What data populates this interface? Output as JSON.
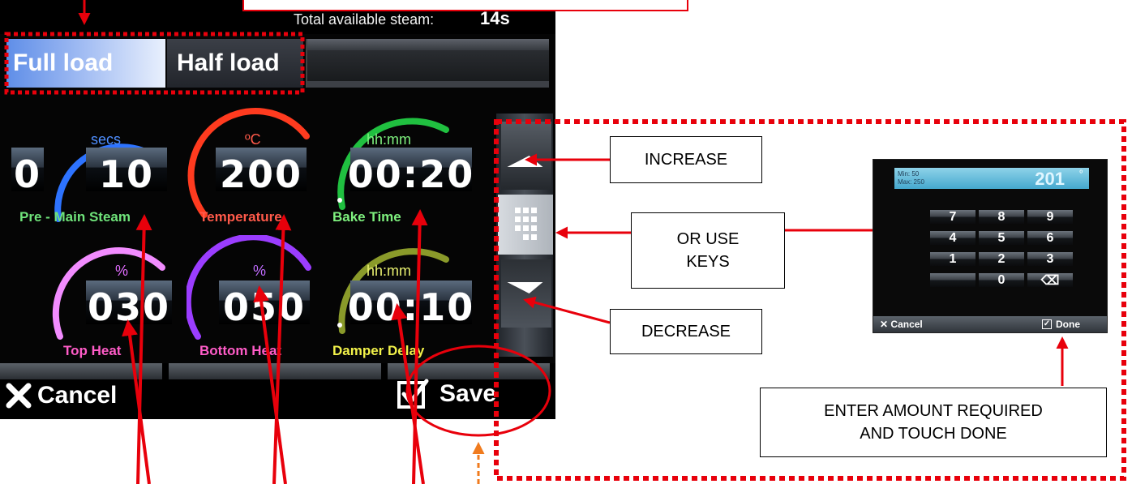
{
  "screen": {
    "steam_label": "Total available steam:",
    "steam_value": "14s",
    "tabs": [
      {
        "label": "Full load",
        "active": true
      },
      {
        "label": "Half load",
        "active": false
      }
    ],
    "gauges": [
      {
        "unit": "secs",
        "left_value": "0",
        "value": "10",
        "label": "Pre - Main Steam",
        "unit_color": "#4f8fff",
        "label_color": "#6fe37a",
        "arc_color": "#2d73ff"
      },
      {
        "unit": "ºC",
        "value": "200",
        "label": "Temperature",
        "unit_color": "#ff5a4a",
        "label_color": "#ff5a4a",
        "arc_color": "#ff3b1f"
      },
      {
        "unit": "hh:mm",
        "value": "00:20",
        "label": "Bake Time",
        "unit_color": "#7ef07e",
        "label_color": "#7ef07e",
        "arc_color": "#20c040"
      },
      {
        "unit": "%",
        "value": "030",
        "label": "Top Heat",
        "unit_color": "#e26cff",
        "label_color": "#ff5cc8",
        "arc_color": "#f28cff"
      },
      {
        "unit": "%",
        "value": "050",
        "label": "Bottom Heat",
        "unit_color": "#c06cff",
        "label_color": "#ff5cc8",
        "arc_color": "#9b3dff"
      },
      {
        "unit": "hh:mm",
        "value": "00:10",
        "label": "Damper Delay",
        "unit_color": "#e8f070",
        "label_color": "#f2f24a",
        "arc_color": "#8a9a2a"
      }
    ],
    "cancel_label": "Cancel",
    "save_label": "Save",
    "icons": {
      "cancel": "x-icon",
      "save": "save-check-icon",
      "keypad": "keypad-icon",
      "increase": "up-arrow-icon",
      "decrease": "down-arrow-icon"
    }
  },
  "annotations": {
    "increase": "INCREASE",
    "keys_line1": "OR USE",
    "keys_line2": "KEYS",
    "decrease": "DECREASE",
    "enter_line1": "ENTER AMOUNT REQUIRED",
    "enter_line2": "AND TOUCH DONE",
    "color": "#e8000b"
  },
  "keypad": {
    "min": "Min: 50",
    "max": "Max: 250",
    "value": "201",
    "unit": "º",
    "keys": [
      "7",
      "8",
      "9",
      "4",
      "5",
      "6",
      "1",
      "2",
      "3",
      "",
      "0",
      "⌫"
    ],
    "cancel_label": "Cancel",
    "done_label": "Done"
  }
}
